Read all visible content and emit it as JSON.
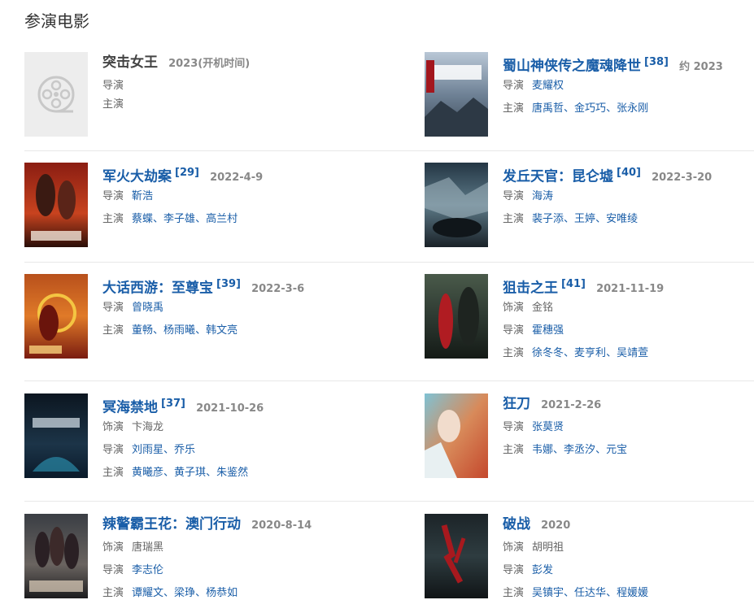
{
  "section_title": "参演电影",
  "labels": {
    "director": "导演",
    "star": "主演",
    "role": "饰演"
  },
  "movies": [
    {
      "title": "突击女王",
      "date": "2023(开机时间)",
      "directors": [],
      "stars": [],
      "roles": []
    },
    {
      "title": "蜀山神侠传之魔魂降世",
      "ref": "[38]",
      "date": "约 2023",
      "directors": [
        "麦耀权"
      ],
      "stars": [
        "唐禹哲",
        "金巧巧",
        "张永刚"
      ],
      "roles": []
    },
    {
      "title": "军火大劫案",
      "ref": "[29]",
      "date": "2022-4-9",
      "directors": [
        "靳浩"
      ],
      "stars": [
        "蔡蝶",
        "李子雄",
        "高兰村"
      ],
      "roles": []
    },
    {
      "title": "发丘天官：昆仑墟",
      "ref": "[40]",
      "date": "2022-3-20",
      "directors": [
        "海涛"
      ],
      "stars": [
        "裴子添",
        "王婷",
        "安唯绫"
      ],
      "roles": []
    },
    {
      "title": "大话西游：至尊宝",
      "ref": "[39]",
      "date": "2022-3-6",
      "directors": [
        "曾晓禹"
      ],
      "stars": [
        "董畅",
        "杨雨曦",
        "韩文亮"
      ],
      "roles": []
    },
    {
      "title": "狙击之王",
      "ref": "[41]",
      "date": "2021-11-19",
      "roles": [
        "金铭"
      ],
      "directors": [
        "霍穗强"
      ],
      "stars": [
        "徐冬冬",
        "麦亨利",
        "吴靖萱"
      ]
    },
    {
      "title": "冥海禁地",
      "ref": "[37]",
      "date": "2021-10-26",
      "roles": [
        "卞海龙"
      ],
      "directors": [
        "刘雨星",
        "乔乐"
      ],
      "stars": [
        "黄曦彦",
        "黄子琪",
        "朱鉴然"
      ]
    },
    {
      "title": "狂刀",
      "date": "2021-2-26",
      "directors": [
        "张莫贤"
      ],
      "stars": [
        "韦娜",
        "李丞汐",
        "元宝"
      ],
      "roles": []
    },
    {
      "title": "辣警霸王花：澳门行动",
      "date": "2020-8-14",
      "roles": [
        "唐瑞黑"
      ],
      "directors": [
        "李志伦"
      ],
      "stars": [
        "谭耀文",
        "梁琤",
        "杨恭如"
      ]
    },
    {
      "title": "破战",
      "date": "2020",
      "roles": [
        "胡明祖"
      ],
      "directors": [
        "彭发"
      ],
      "stars": [
        "吴镇宇",
        "任达华",
        "程媛媛"
      ]
    }
  ],
  "colors": {
    "link": "#1a5ea8",
    "label": "#666666",
    "date": "#888888",
    "divider": "#e8e8e8"
  }
}
